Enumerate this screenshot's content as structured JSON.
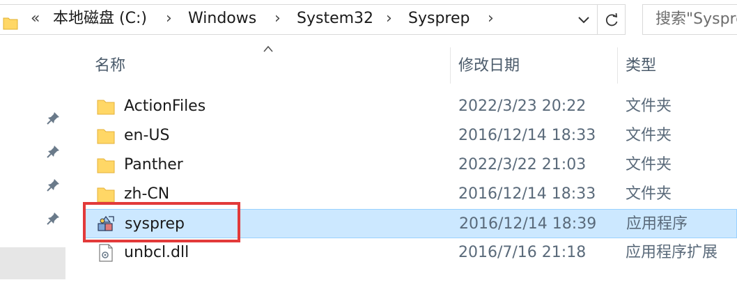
{
  "address_bar": {
    "overflow_glyph": "«",
    "separator": "›",
    "breadcrumbs": [
      "本地磁盘 (C:)",
      "Windows",
      "System32",
      "Sysprep"
    ]
  },
  "search": {
    "placeholder": "搜索\"Sysprep\""
  },
  "columns": {
    "name": "名称",
    "date": "修改日期",
    "type": "类型"
  },
  "files": [
    {
      "name": "ActionFiles",
      "date": "2022/3/23 20:22",
      "type": "文件夹",
      "icon": "folder-icon"
    },
    {
      "name": "en-US",
      "date": "2016/12/14 18:33",
      "type": "文件夹",
      "icon": "folder-icon"
    },
    {
      "name": "Panther",
      "date": "2022/3/22 21:03",
      "type": "文件夹",
      "icon": "folder-icon"
    },
    {
      "name": "zh-CN",
      "date": "2016/12/14 18:33",
      "type": "文件夹",
      "icon": "folder-icon"
    },
    {
      "name": "sysprep",
      "date": "2016/12/14 18:39",
      "type": "应用程序",
      "icon": "sysprep-app-icon",
      "selected": true
    },
    {
      "name": "unbcl.dll",
      "date": "2016/7/16 21:18",
      "type": "应用程序扩展",
      "icon": "dll-file-icon"
    }
  ],
  "colors": {
    "selection_bg": "#cce8ff",
    "selection_border": "#99d1ff",
    "annotation": "#e23a3a",
    "folder": "#ffd766"
  }
}
